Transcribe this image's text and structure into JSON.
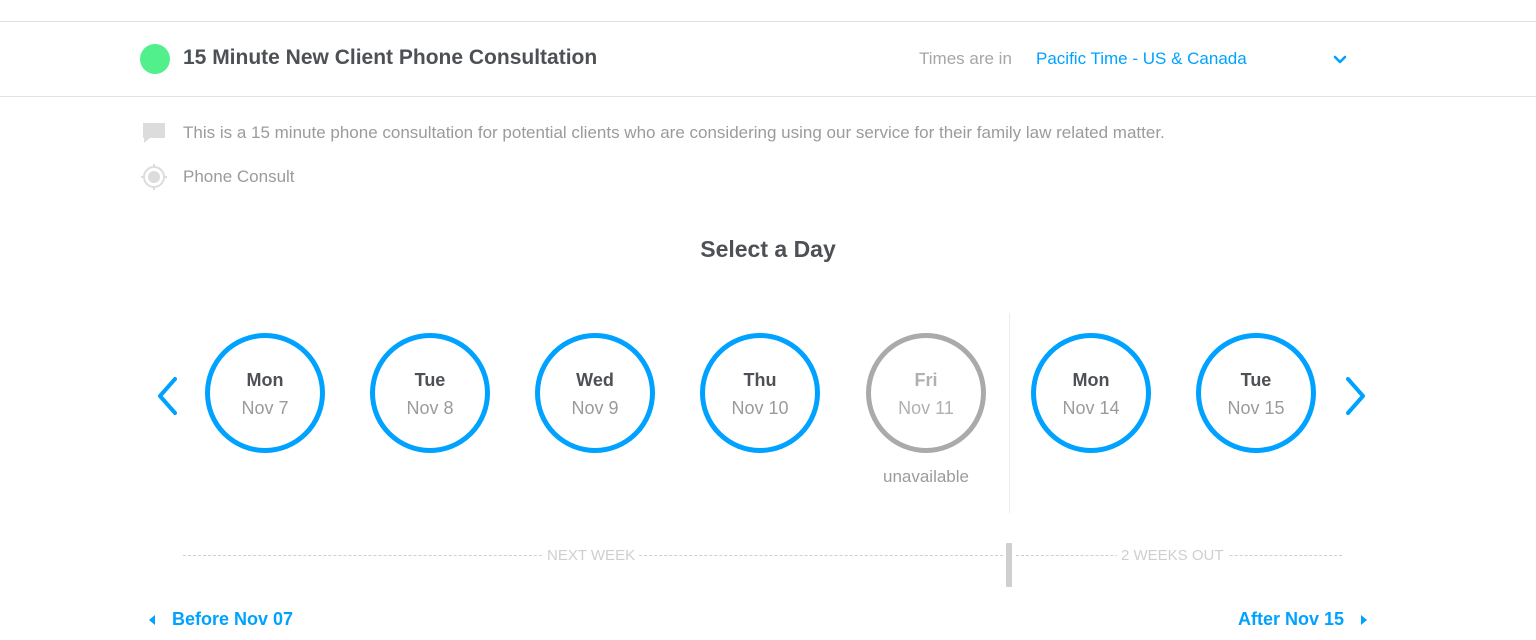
{
  "colors": {
    "accent": "#00a2ff",
    "dot": "#52f08c",
    "unavailable": "#aaaaaa"
  },
  "header": {
    "event_title": "15 Minute New Client Phone Consultation",
    "timezone_prefix": "Times are in",
    "timezone_value": "Pacific Time - US & Canada",
    "timezone_icon": "chevron-down-icon"
  },
  "details": {
    "description": "This is a 15 minute phone consultation for potential clients who are considering using our service for their family law related matter.",
    "description_icon": "comment-icon",
    "location": "Phone Consult",
    "location_icon": "location-target-icon"
  },
  "heading": "Select a Day",
  "days": [
    {
      "weekday": "Mon",
      "date": "Nov 7",
      "available": true
    },
    {
      "weekday": "Tue",
      "date": "Nov 8",
      "available": true
    },
    {
      "weekday": "Wed",
      "date": "Nov 9",
      "available": true
    },
    {
      "weekday": "Thu",
      "date": "Nov 10",
      "available": true
    },
    {
      "weekday": "Fri",
      "date": "Nov 11",
      "available": false,
      "status": "unavailable"
    },
    {
      "weekday": "Mon",
      "date": "Nov 14",
      "available": true
    },
    {
      "weekday": "Tue",
      "date": "Nov 15",
      "available": true
    }
  ],
  "weeks": {
    "next_week": "NEXT WEEK",
    "two_weeks_out": "2 WEEKS OUT"
  },
  "nav": {
    "before": "Before Nov 07",
    "after": "After Nov 15"
  }
}
